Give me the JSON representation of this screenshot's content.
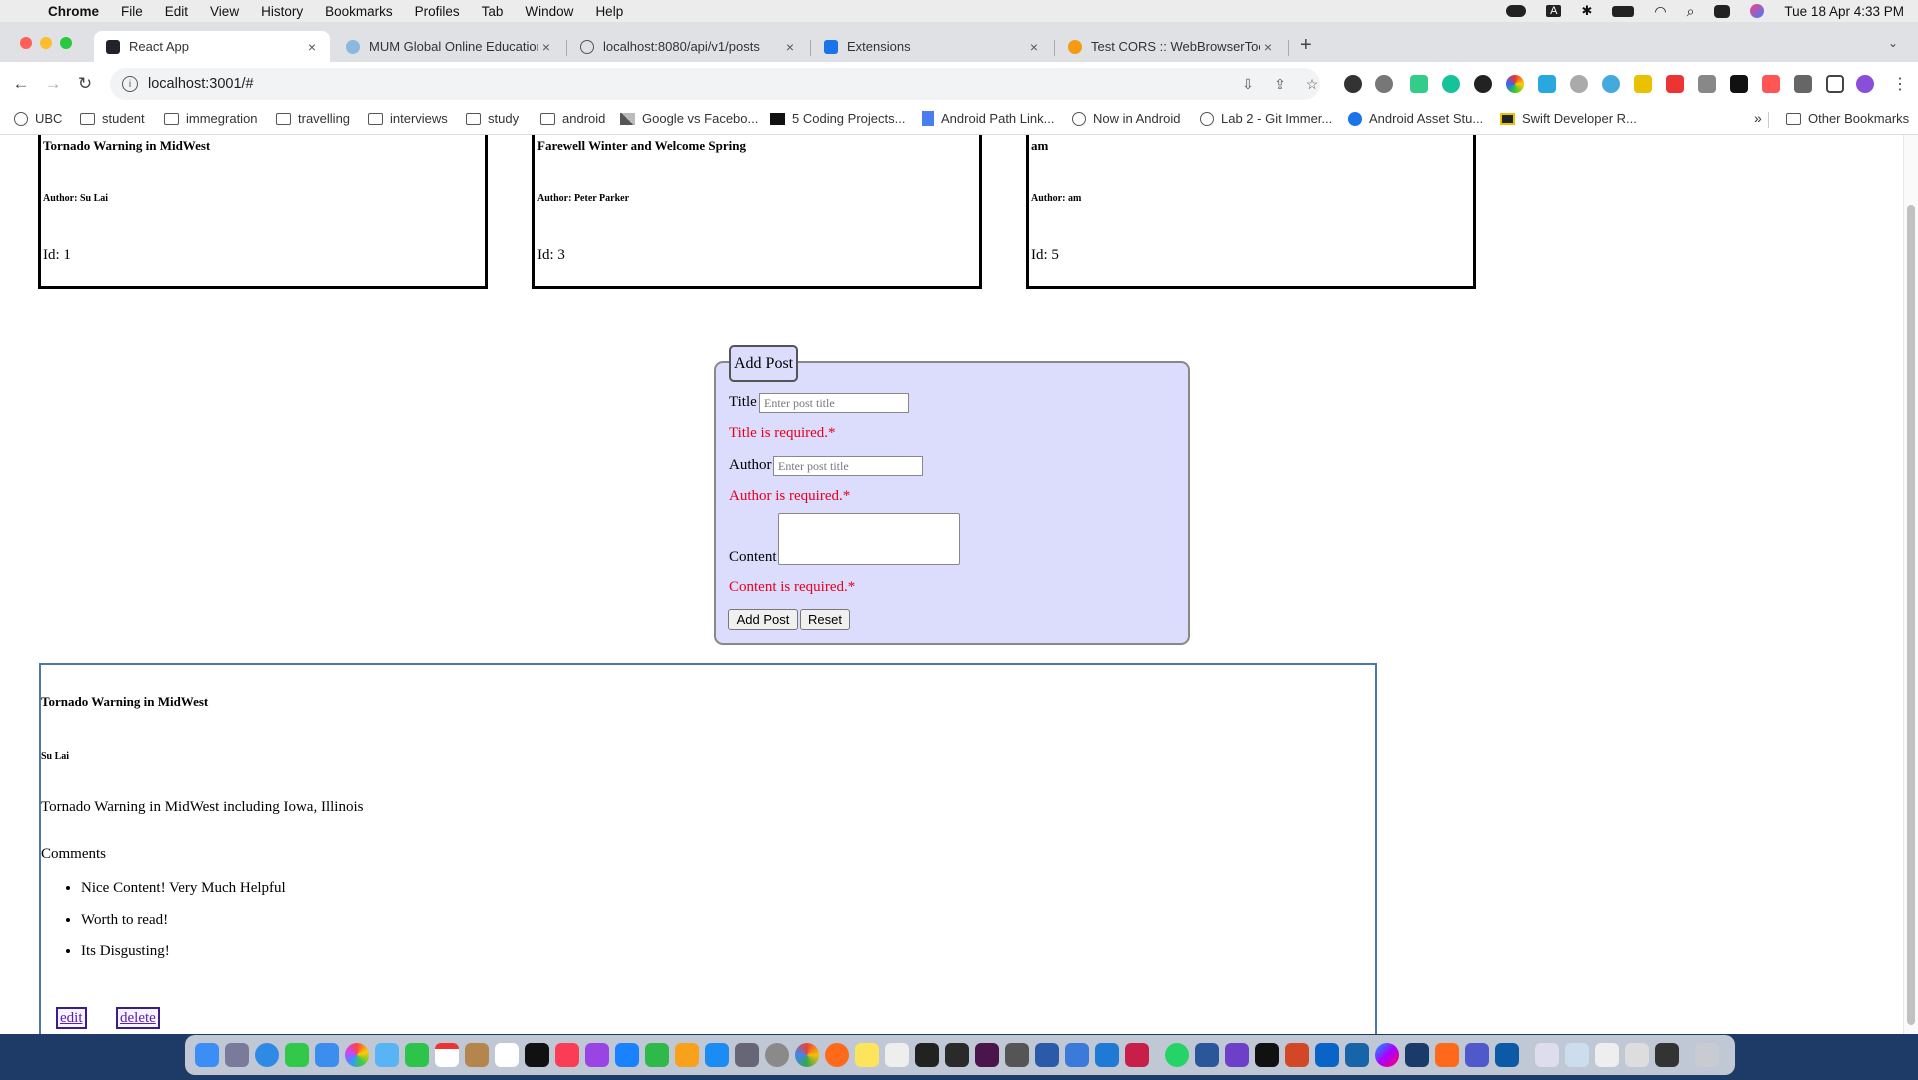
{
  "menubar": {
    "app": "Chrome",
    "items": [
      "File",
      "Edit",
      "View",
      "History",
      "Bookmarks",
      "Profiles",
      "Tab",
      "Window",
      "Help"
    ],
    "datetime": "Tue 18 Apr  4:33 PM",
    "input_indicator": "A"
  },
  "tabs": [
    {
      "title": "React App",
      "active": true
    },
    {
      "title": "MUM Global Online Education",
      "active": false
    },
    {
      "title": "localhost:8080/api/v1/posts",
      "active": false
    },
    {
      "title": "Extensions",
      "active": false
    },
    {
      "title": "Test CORS :: WebBrowserTools",
      "active": false
    }
  ],
  "tab_icons": {
    "close": "×",
    "new_tab": "+"
  },
  "address_bar": {
    "url": "localhost:3001/#"
  },
  "bookmarks": [
    {
      "label": "UBC",
      "icon": "globe-icon"
    },
    {
      "label": "student",
      "icon": "folder-icon"
    },
    {
      "label": "immegration",
      "icon": "folder-icon"
    },
    {
      "label": "travelling",
      "icon": "folder-icon"
    },
    {
      "label": "interviews",
      "icon": "folder-icon"
    },
    {
      "label": "study",
      "icon": "folder-icon"
    },
    {
      "label": "android",
      "icon": "folder-icon"
    },
    {
      "label": "Google vs Facebo...",
      "icon": "chart-icon"
    },
    {
      "label": "5 Coding Projects...",
      "icon": "site-icon"
    },
    {
      "label": "Android Path Link...",
      "icon": "doc-icon"
    },
    {
      "label": "Now in Android",
      "icon": "globe-icon"
    },
    {
      "label": "Lab 2 - Git Immer...",
      "icon": "globe-icon"
    },
    {
      "label": "Android Asset Stu...",
      "icon": "tool-icon"
    },
    {
      "label": "Swift Developer R...",
      "icon": "book-icon"
    }
  ],
  "other_bookmarks": "Other Bookmarks",
  "bookmarks_overflow": "»",
  "posts": [
    {
      "title": "Tornado Warning in MidWest",
      "author": "Author: Su Lai",
      "id": "Id: 1"
    },
    {
      "title": "Farewell Winter and Welcome Spring",
      "author": "Author: Peter Parker",
      "id": "Id: 3"
    },
    {
      "title": "am",
      "author": "Author: am",
      "id": "Id: 5"
    }
  ],
  "form": {
    "legend": "Add Post",
    "title_label": "Title",
    "title_placeholder": "Enter post title",
    "title_error": "Title is required.*",
    "author_label": "Author",
    "author_placeholder": "Enter post title",
    "author_error": "Author is required.*",
    "content_label": "Content",
    "content_error": "Content is required.*",
    "submit_label": "Add Post",
    "reset_label": "Reset"
  },
  "detail": {
    "title": "Tornado Warning in MidWest",
    "author": "Su Lai",
    "content": "Tornado Warning in MidWest including Iowa, Illinois",
    "comments_heading": "Comments",
    "comments": [
      "Nice Content! Very Much Helpful",
      "Worth to read!",
      "Its Disgusting!"
    ],
    "edit_label": "edit",
    "delete_label": "delete"
  },
  "colors": {
    "error": "#e8001c",
    "form_bg": "#dcdcfc",
    "detail_border": "#4a78a8",
    "tab_strip": "#dfe1e5"
  }
}
